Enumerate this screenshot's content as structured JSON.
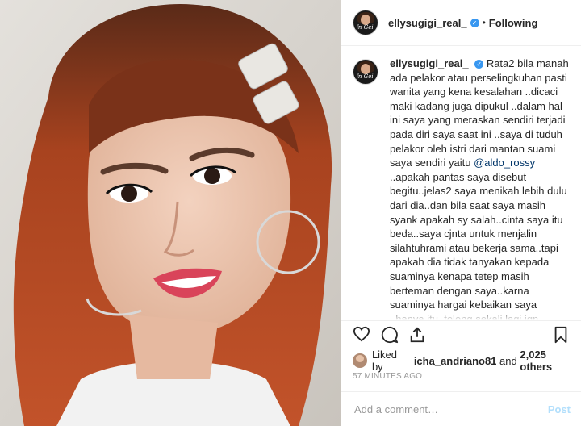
{
  "header": {
    "username": "ellysugigi_real_",
    "separator": "•",
    "follow_status": "Following"
  },
  "caption": {
    "username": "ellysugigi_real_",
    "text_before_mention": "Rata2 bila manah ada pelakor atau perselingkuhan pasti wanita yang kena kesalahan ..dicaci maki kadang juga dipukul ..dalam hal ini saya yang meraskan sendiri terjadi pada diri saya saat ini ..saya di tuduh pelakor oleh istri dari mantan suami saya sendiri yaitu",
    "mention": "@aldo_rossy",
    "text_after_mention": "..apakah pantas saya disebut begitu..jelas2 saya menikah lebih dulu dari dia..dan bila saat saya masih syank apakah sy salah..cinta saya itu beda..saya cjnta untuk menjalin silahtuhrami atau bekerja sama..tapi apakah dia tidak tanyakan kepada suaminya kenapa tetep masih berteman dengan saya..karna suaminya hargai kebaikan saya ..hanya itu..tolong sekali lagi jgn"
  },
  "likes": {
    "prefix": "Liked by",
    "user": "icha_andriano81",
    "conjunction": "and",
    "others": "2,025 others"
  },
  "timestamp": "57 MINUTES AGO",
  "comment_box": {
    "placeholder": "Add a comment…",
    "post_label": "Post"
  },
  "avatar_text": "ʃn Gei",
  "icons": [
    "heart-icon",
    "comment-icon",
    "share-icon",
    "bookmark-icon",
    "verified-badge-icon"
  ],
  "colors": {
    "verified": "#3897f0",
    "mention": "#003569",
    "post_disabled": "#b2dffc"
  }
}
